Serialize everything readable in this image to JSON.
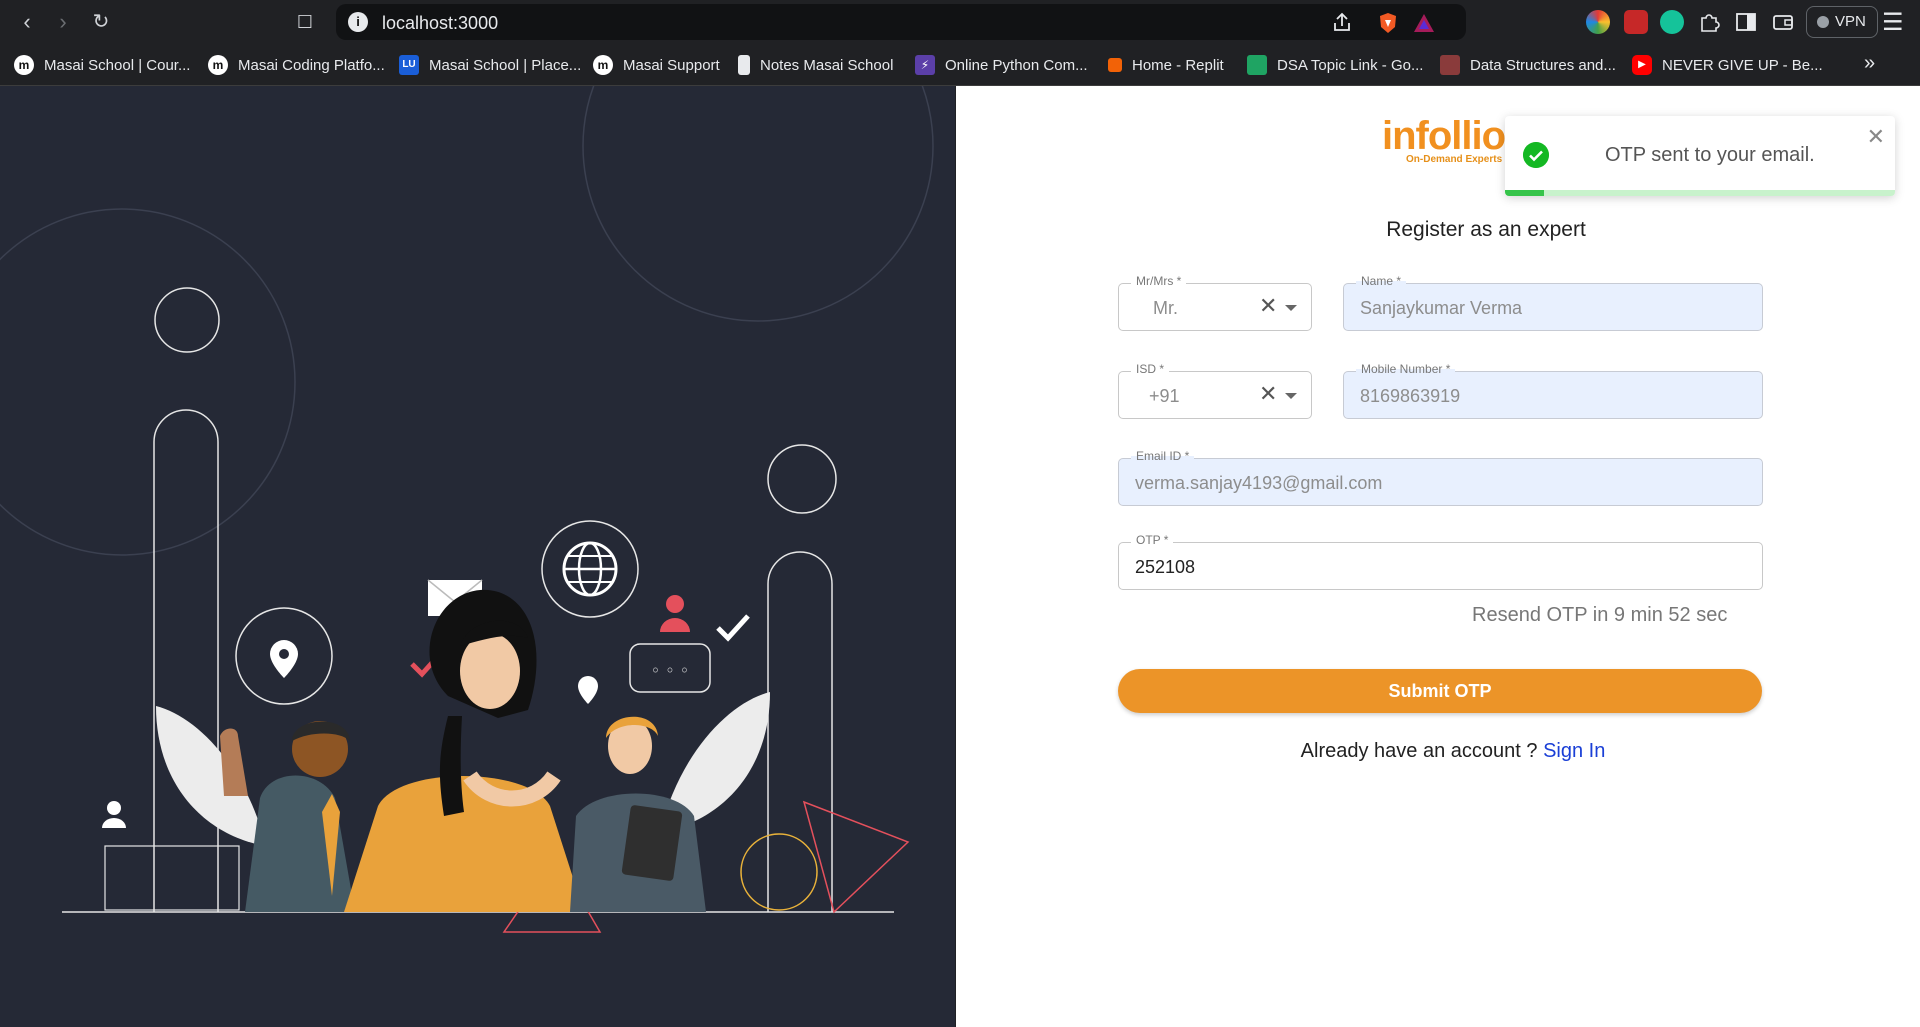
{
  "browser": {
    "url": "localhost:3000",
    "vpn_label": "VPN"
  },
  "bookmarks": [
    {
      "label": "Masai School | Cour...",
      "icon": "masai-icon"
    },
    {
      "label": "Masai Coding Platfo...",
      "icon": "masai-icon"
    },
    {
      "label": "Masai School | Place...",
      "icon": "lu-icon",
      "icon_text": "LU"
    },
    {
      "label": "Masai Support",
      "icon": "masai-icon"
    },
    {
      "label": "Notes Masai School",
      "icon": "notes-icon"
    },
    {
      "label": "Online Python Com...",
      "icon": "bolt-icon"
    },
    {
      "label": "Home - Replit",
      "icon": "replit-icon"
    },
    {
      "label": "DSA Topic Link - Go...",
      "icon": "sheets-icon"
    },
    {
      "label": "Data Structures and...",
      "icon": "pd-icon"
    },
    {
      "label": "NEVER GIVE UP - Be...",
      "icon": "youtube-icon"
    }
  ],
  "logo": {
    "name": "infollion",
    "tagline": "On-Demand Experts"
  },
  "form": {
    "heading": "Register as an expert",
    "salutation": {
      "label": "Mr/Mrs *",
      "value": "Mr."
    },
    "name": {
      "label": "Name *",
      "value": "Sanjaykumar Verma"
    },
    "isd": {
      "label": "ISD *",
      "value": "+91"
    },
    "mobile": {
      "label": "Mobile Number *",
      "value": "8169863919"
    },
    "email": {
      "label": "Email ID *",
      "value": "verma.sanjay4193@gmail.com"
    },
    "otp": {
      "label": "OTP *",
      "value": "252108"
    },
    "resend_text": "Resend OTP in 9 min 52 sec",
    "submit_label": "Submit OTP",
    "signin_prompt": "Already have an account ? ",
    "signin_link": "Sign In"
  },
  "toast": {
    "message": "OTP sent to your email.",
    "progress": 0.1
  },
  "colors": {
    "accent": "#ec9428",
    "link": "#1a3fd6",
    "success": "#14b823",
    "panel_dark": "#252936"
  }
}
